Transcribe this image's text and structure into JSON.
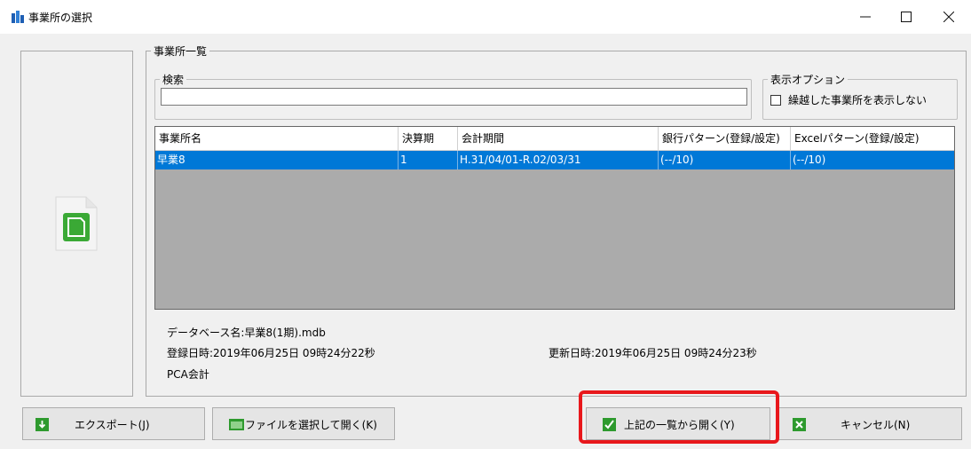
{
  "window": {
    "title": "事業所の選択",
    "min_glyph": "—",
    "max_glyph": "☐",
    "close_glyph": "✕"
  },
  "list_group": {
    "title": "事業所一覧",
    "search": {
      "label": "検索",
      "value": "",
      "placeholder": ""
    },
    "options": {
      "label": "表示オプション",
      "checkbox_label": "繰越した事業所を表示しない",
      "checked": false
    }
  },
  "table": {
    "columns": [
      "事業所名",
      "決算期",
      "会計期間",
      "銀行パターン(登録/設定)",
      "Excelパターン(登録/設定)"
    ],
    "rows": [
      {
        "name": "早業8",
        "period": "1",
        "fiscal": "H.31/04/01-R.02/03/31",
        "bank": "(--/10)",
        "excel": "(--/10)",
        "selected": true
      }
    ]
  },
  "details": {
    "db_name": "データベース名:早業8(1期).mdb",
    "created": "登録日時:2019年06月25日 09時24分22秒",
    "updated": "更新日時:2019年06月25日 09時24分23秒",
    "software": "PCA会計"
  },
  "buttons": {
    "export": "エクスポート(J)",
    "open_file": "ファイルを選択して開く(K)",
    "open_from_list": "上記の一覧から開く(Y)",
    "cancel": "キャンセル(N)"
  },
  "colors": {
    "selection": "#0078d7",
    "highlight": "#e8181c",
    "icon_green": "#2e9a2e"
  }
}
